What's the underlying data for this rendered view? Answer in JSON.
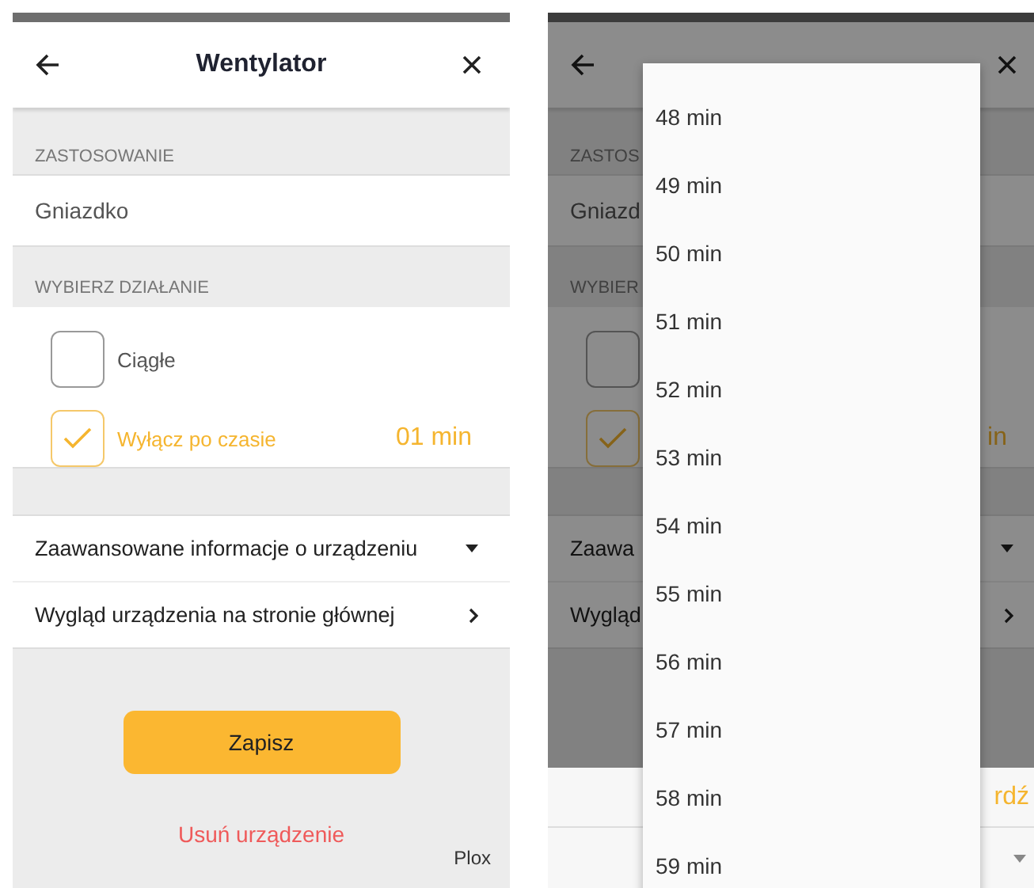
{
  "screens": [
    {
      "kind": "form",
      "title": "Wentylator",
      "usage_label": "ZASTOSOWANIE",
      "usage_value": "Gniazdko",
      "action_label": "WYBIERZ DZIAŁANIE",
      "options": [
        {
          "label": "Ciągłe",
          "checked": false
        },
        {
          "label": "Wyłącz po czasie",
          "checked": true,
          "value": "01 min"
        }
      ],
      "links": [
        {
          "label": "Zaawansowane informacje o urządzeniu",
          "kind": "dropdown"
        },
        {
          "label": "Wygląd urządzenia na stronie głównej",
          "kind": "chevron"
        }
      ],
      "save_button": "Zapisz",
      "delete_link": "Usuń urządzenie",
      "brand": "Plox"
    },
    {
      "kind": "picker",
      "usage_label": "ZASTOS",
      "usage_value": "Gniazd",
      "action_label": "WYBIER",
      "options": [
        {
          "checked": false
        },
        {
          "checked": true,
          "value": "in"
        }
      ],
      "links": [
        {
          "label": "Zaawa",
          "kind": "dropdown"
        },
        {
          "label": "Wygląd",
          "kind": "chevron"
        }
      ],
      "sheet": {
        "confirm": "rdź"
      },
      "picker_items": [
        "48 min",
        "49 min",
        "50 min",
        "51 min",
        "52 min",
        "53 min",
        "54 min",
        "55 min",
        "56 min",
        "57 min",
        "58 min",
        "59 min"
      ]
    }
  ]
}
